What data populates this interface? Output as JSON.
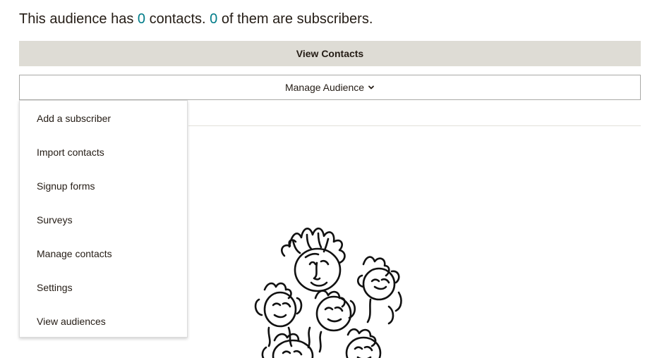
{
  "summary": {
    "prefix": "This audience has ",
    "contacts_count": "0",
    "middle": " contacts. ",
    "subscribers_count": "0",
    "suffix": " of them are subscribers."
  },
  "buttons": {
    "view_contacts": "View Contacts",
    "manage_audience": "Manage Audience"
  },
  "dropdown": {
    "items": [
      {
        "label": "Add a subscriber"
      },
      {
        "label": "Import contacts"
      },
      {
        "label": "Signup forms"
      },
      {
        "label": "Surveys"
      },
      {
        "label": "Manage contacts"
      },
      {
        "label": "Settings"
      },
      {
        "label": "View audiences"
      }
    ]
  },
  "icons": {
    "manage_audience_chevron": "chevron-down-icon",
    "illustration": "crowd-of-faces-illustration"
  },
  "colors": {
    "accent_number": "#007c89",
    "primary_button_bg": "#dedcd5",
    "text": "#241c15"
  }
}
